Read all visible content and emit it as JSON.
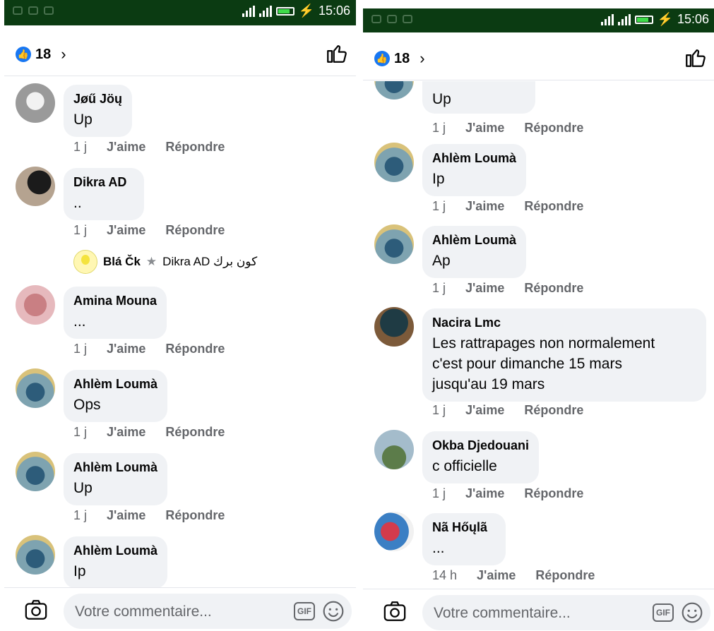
{
  "status": {
    "time": "15:06"
  },
  "header": {
    "like_count": "18"
  },
  "footer": {
    "placeholder": "Votre commentaire...",
    "gif_label": "GIF"
  },
  "actions": {
    "like": "J'aime",
    "reply": "Répondre"
  },
  "left": {
    "comments": [
      {
        "author": "Jøű Jöų",
        "text": "Up",
        "time": "1 j"
      },
      {
        "author": "Dikra AD",
        "text": "..",
        "time": "1 j"
      },
      {
        "author": "Amina Mouna",
        "text": "...",
        "time": "1 j"
      },
      {
        "author": "Ahlèm Loumà",
        "text": "Ops",
        "time": "1 j"
      },
      {
        "author": "Ahlèm Loumà",
        "text": "Up",
        "time": "1 j"
      },
      {
        "author": "Ahlèm Loumà",
        "text": "Ip",
        "time": ""
      }
    ],
    "reply_preview": {
      "author": "Blá Čk",
      "text": "Dikra AD كون برك"
    }
  },
  "right": {
    "comments": [
      {
        "author": "",
        "text": "Up",
        "time": "1 j"
      },
      {
        "author": "Ahlèm Loumà",
        "text": "Ip",
        "time": "1 j"
      },
      {
        "author": "Ahlèm Loumà",
        "text": "Ap",
        "time": "1 j"
      },
      {
        "author": "Nacira Lmc",
        "text_lines": [
          "Les rattrapages  non normalement",
          "c'est pour dimanche 15 mars",
          "jusqu'au 19 mars"
        ],
        "time": "1 j"
      },
      {
        "author": "Okba Djedouani",
        "text": "c officielle",
        "time": "1 j"
      },
      {
        "author": "Nã Hőųlã",
        "text": "...",
        "time": "14 h"
      }
    ]
  },
  "colors": {
    "status_bar": "#0b3b12",
    "like_blue": "#1877f2",
    "bubble": "#f0f2f5",
    "meta_gray": "#65676b"
  }
}
